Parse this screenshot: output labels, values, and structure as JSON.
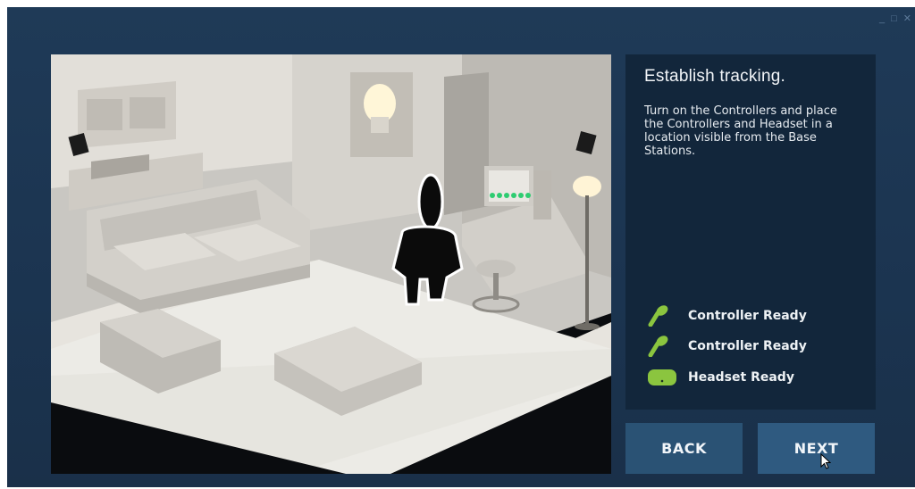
{
  "window_controls": {
    "minimize": "_",
    "maximize": "□",
    "close": "✕"
  },
  "panel": {
    "title": "Establish tracking.",
    "description": "Turn on the Controllers and place the Controllers and Headset in a location visible from the Base Stations.",
    "statuses": [
      {
        "label": "Controller Ready",
        "icon": "controller-icon"
      },
      {
        "label": "Controller Ready",
        "icon": "controller-icon"
      },
      {
        "label": "Headset Ready",
        "icon": "headset-icon"
      }
    ]
  },
  "buttons": {
    "back": "BACK",
    "next": "NEXT"
  },
  "colors": {
    "background": "#1f3a57",
    "panel": "#12263b",
    "button": "#2a5274",
    "ready_green": "#8bc53f"
  }
}
